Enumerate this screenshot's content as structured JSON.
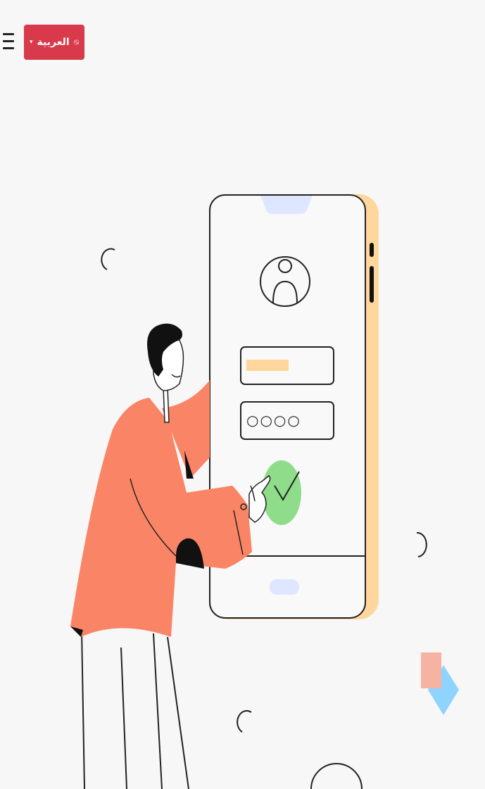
{
  "header": {
    "menu_icon": "hamburger-menu-icon",
    "language": {
      "label": "العربية",
      "caret": "▾",
      "icon": "translate-icon",
      "background": "#d83a4b"
    }
  },
  "illustration": {
    "description_icon": "login-illustration",
    "password_mask": "○○○○",
    "colors": {
      "shirt": "#f98466",
      "phone_accent": "#ffd79c",
      "check": "#8fdc8b",
      "notch": "#dfe6ff",
      "square": "#f6b3a3",
      "diamond": "#8fd3ff"
    }
  }
}
